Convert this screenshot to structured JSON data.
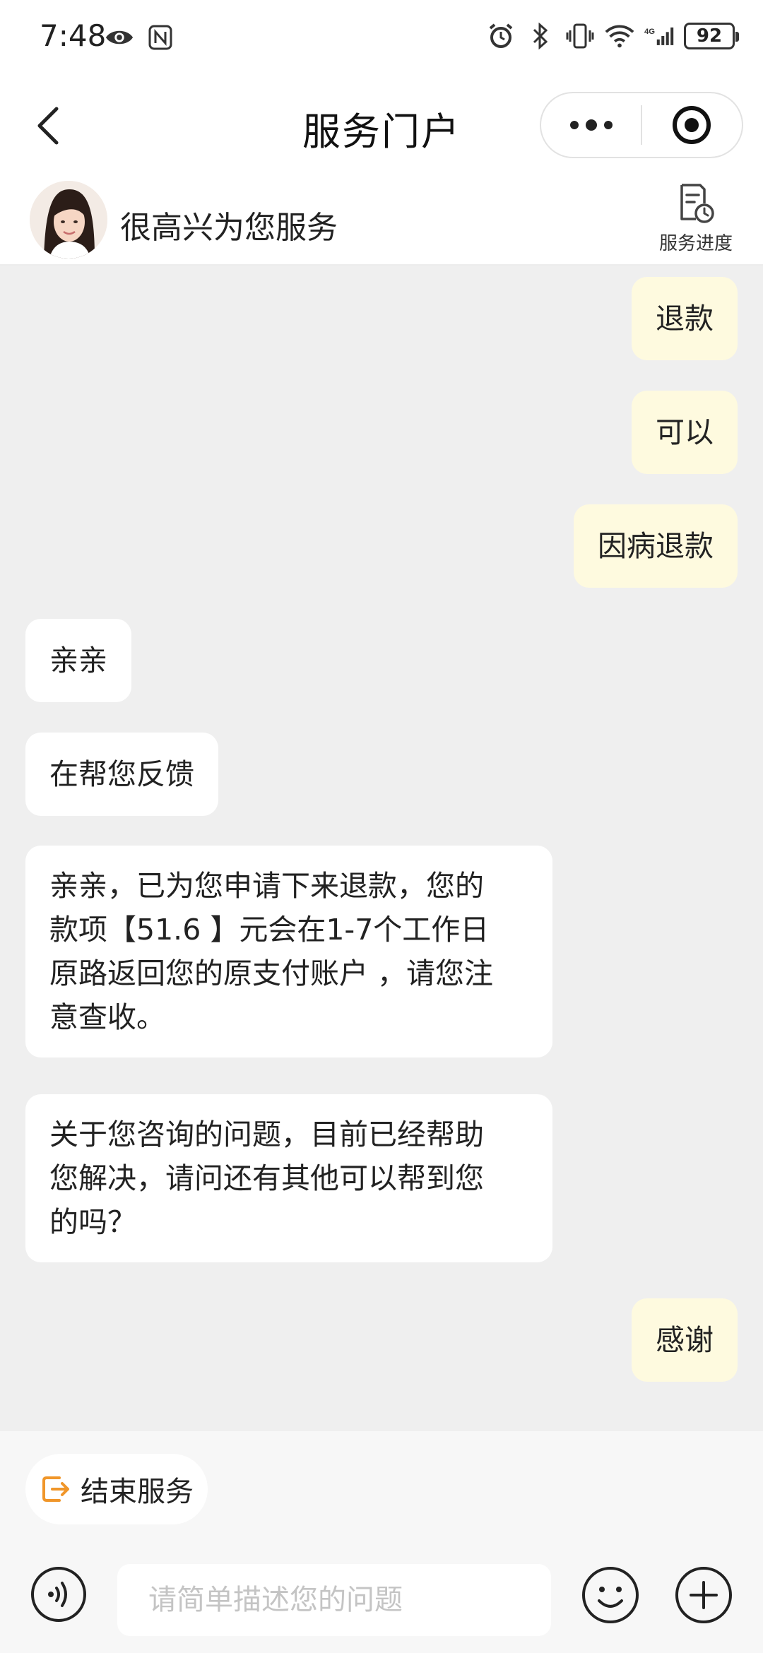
{
  "status_bar": {
    "time": "7:48",
    "battery": "92",
    "icons": [
      "eye-icon",
      "nfc-icon",
      "alarm-icon",
      "bluetooth-icon",
      "vibrate-icon",
      "wifi-icon",
      "4g-signal-icon",
      "battery-icon"
    ]
  },
  "nav": {
    "title": "服务门户",
    "back_icon": "chevron-left-icon",
    "more_icon": "more-dots-icon",
    "close_icon": "target-circle-icon"
  },
  "agent": {
    "greeting": "很高兴为您服务",
    "progress_label": "服务进度"
  },
  "messages": [
    {
      "role": "user",
      "text": "退款"
    },
    {
      "role": "user",
      "text": "可以"
    },
    {
      "role": "user",
      "text": "因病退款"
    },
    {
      "role": "agent",
      "text": "亲亲"
    },
    {
      "role": "agent",
      "text": "在帮您反馈"
    },
    {
      "role": "agent",
      "lines": [
        "亲亲，已为您申请下来退款，您的",
        "款项【51.6 】元会在1-7个工作日",
        "原路返回您的原支付账户 ，请您注",
        "意查收。"
      ]
    },
    {
      "role": "agent",
      "lines": [
        "关于您咨询的问题，目前已经帮助",
        "您解决，请问还有其他可以帮到您",
        "的吗？"
      ]
    },
    {
      "role": "user",
      "text": "感谢"
    }
  ],
  "bottom": {
    "end_service_label": "结束服务",
    "input_placeholder": "请简单描述您的问题",
    "input_value": ""
  },
  "colors": {
    "user_bubble": "#fefadf",
    "agent_bubble": "#ffffff",
    "chat_background": "#efefef",
    "end_service_icon": "#f0962a"
  }
}
